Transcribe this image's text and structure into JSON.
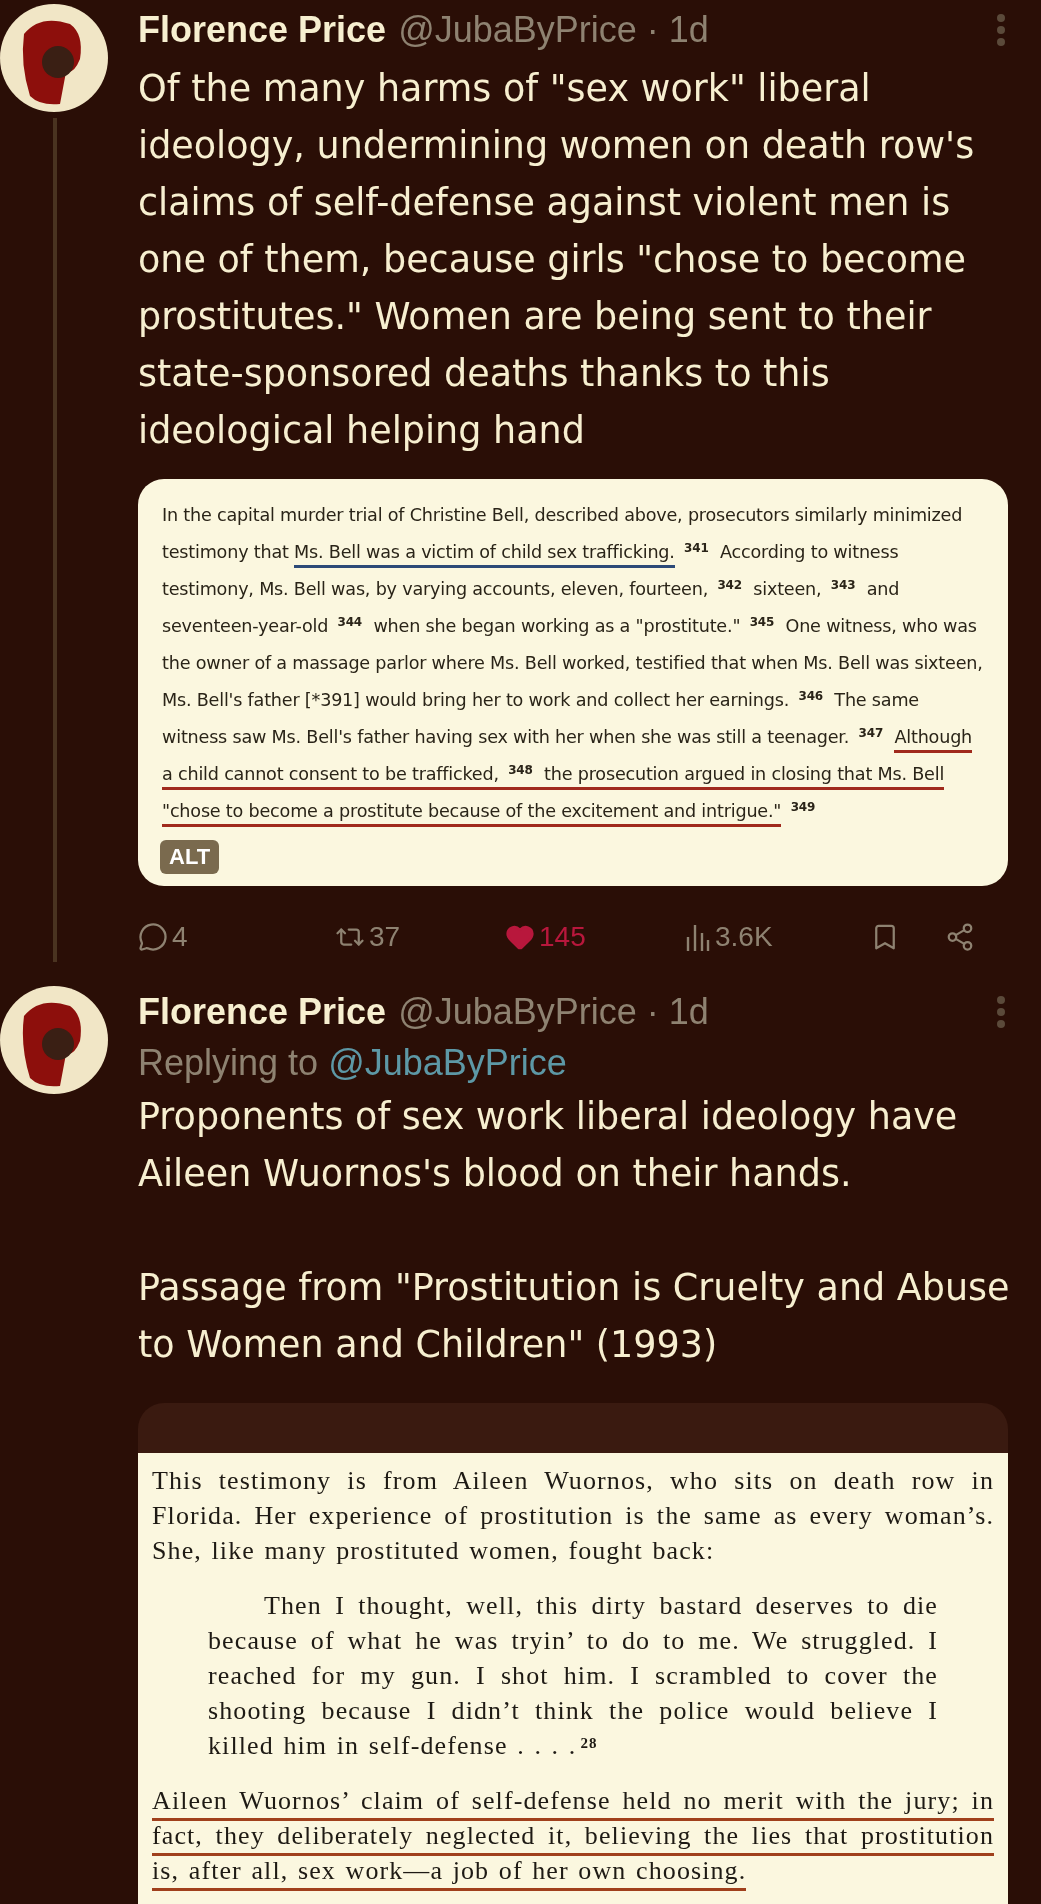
{
  "tweets": [
    {
      "author": "Florence Price",
      "handle": "@JubaByPrice",
      "time": "· 1d",
      "text": [
        "Of the many harms of \"sex work\" liberal ideology, undermining women on death row's claims of self-defense against violent men is one of them, because girls \"chose to become prostitutes.\" Women are being sent to their state-sponsored deaths thanks to this ideological helping hand"
      ],
      "attachment": {
        "kind": "web",
        "badge": "ALT",
        "paragraphs": [
          {
            "segments": [
              {
                "text": "In the capital murder trial of Christine Bell, described above, prosecutors similarly minimized testimony that "
              },
              {
                "text": "Ms. Bell was a victim of child sex trafficking.",
                "color": "#2c4a78"
              },
              {
                "text": " $^{341}$ According to witness testimony, Ms. Bell was, by varying accounts, eleven, fourteen, $^{342}$ sixteen, $^{343}$ and seventeen-year-old $^{344}$ when she began working as a \"prostitute.\" $^{345}$ One witness, who was the owner of a massage parlor where Ms. Bell worked, testified that when Ms. Bell was sixteen, Ms. Bell's father [*391] would bring her to work and collect her earnings. $^{346}$ The same witness saw Ms. Bell's father having sex with her when she was still a teenager. $^{347}$ "
              },
              {
                "text": "Although a child cannot consent to be trafficked, $^{348}$ the prosecution argued in closing that Ms. Bell \"chose to become a prostitute because of the excitement and intrigue.\"",
                "color": "#a02a1c"
              },
              {
                "text": " $^{349}$"
              }
            ]
          }
        ]
      },
      "liked": true,
      "actions": [
        {
          "kind": "reply",
          "count": "4"
        },
        {
          "kind": "repost",
          "count": "37"
        },
        {
          "kind": "like",
          "count": "145"
        },
        {
          "kind": "views",
          "count": "3.6K"
        },
        {
          "kind": "bookmark"
        },
        {
          "kind": "share"
        }
      ]
    },
    {
      "author": "Florence Price",
      "handle": "@JubaByPrice",
      "time": "· 1d",
      "replying_to": {
        "label": "Replying to",
        "handle": "@JubaByPrice"
      },
      "text": [
        "Proponents of sex work liberal ideology have Aileen Wuornos's blood on their hands.",
        "Passage from \"Prostitution is Cruelty and Abuse to Women and Children\" (1993)"
      ],
      "attachment": {
        "kind": "book",
        "paragraphs": [
          {
            "kind": "body",
            "segments": [
              {
                "text": "This testimony is from Aileen Wuornos, who sits on death row in Florida. Her experience of prostitution is the same as every woman’s. She, like many prostituted women, fought back:"
              }
            ]
          },
          {
            "kind": "quote",
            "segments": [
              {
                "text": "Then I thought, well, this dirty bastard deserves to die because of what he was tryin’ to do to me. We struggled. I reached for my gun. I shot him. I scrambled to cover the shooting because I didn’t think the police would believe I killed him in self-defense . . . .$^{28}$"
              }
            ]
          },
          {
            "kind": "body",
            "segments": [
              {
                "text": "Aileen Wuornos’ claim of self-defense held no merit with the jury; in fact, they deliberately neglected it, believing the lies that prostitution is, after all, sex work—a job of her own choosing.",
                "color": "#a0401c"
              }
            ]
          }
        ]
      }
    }
  ]
}
